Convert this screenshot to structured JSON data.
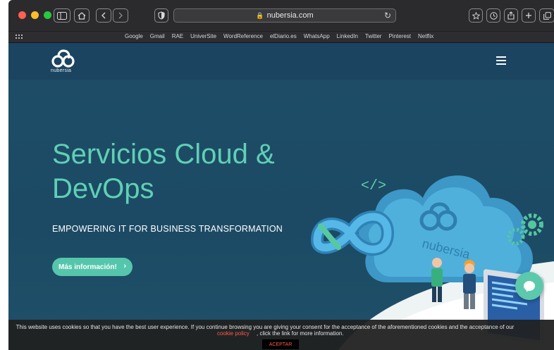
{
  "browser": {
    "url": "nubersia.com",
    "favorites": [
      "Google",
      "Gmail",
      "RAE",
      "UniverSite",
      "WordReference",
      "elDiario.es",
      "WhatsApp",
      "LinkedIn",
      "Twitter",
      "Pinterest",
      "Netflix"
    ],
    "icons": {
      "sidebar": "sidebar-icon",
      "home": "home-icon",
      "back": "chevron-left-icon",
      "forward": "chevron-right-icon",
      "shield": "shield-icon",
      "lock": "lock-icon",
      "reload": "reload-icon",
      "star": "star-icon",
      "history": "clock-icon",
      "share": "share-icon",
      "new_tab": "plus-icon",
      "tabs": "tabs-icon",
      "favorites_grid": "grid-icon"
    }
  },
  "site": {
    "logo_text": "nubersia",
    "menu_icon": "hamburger-icon",
    "hero": {
      "title": "Servicios Cloud & DevOps",
      "subtitle": "EMPOWERING IT FOR BUSINESS TRANSFORMATION",
      "cta_label": "Más información!",
      "cta_icon": "chevron-right-icon"
    },
    "illustration_text": "nubersia"
  },
  "cookie": {
    "text": "This website uses cookies so that you have the best user experience. If you continue browsing you are giving your consent for the acceptance of the aforementioned cookies and the acceptance of our",
    "link_text": "cookie policy",
    "link_suffix": ", click the link for more information.",
    "accept_label": "ACEPTAR"
  },
  "chat": {
    "icon": "chat-bubble-icon"
  },
  "colors": {
    "accent": "#5fd0b5",
    "page_bg": "#1e4d67",
    "cookie_link": "#ff5a4a"
  }
}
